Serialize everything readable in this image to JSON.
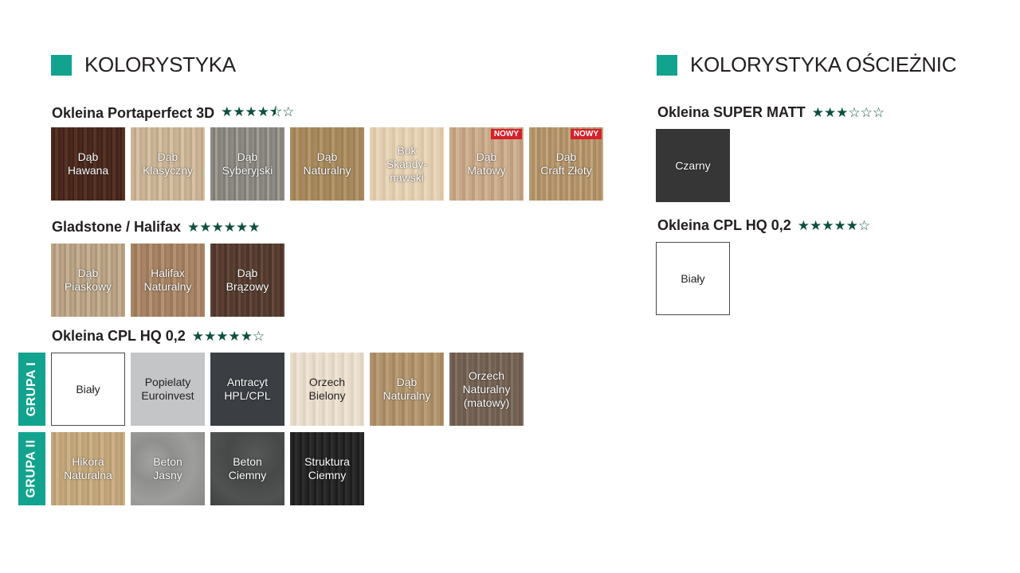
{
  "left": {
    "title": "KOLORYSTYKA",
    "groups": [
      {
        "name": "Okleina Portaperfect 3D",
        "stars": "★★★★⯪☆",
        "rating": 4.5,
        "swatches": [
          {
            "label": "Dąb\nHawana"
          },
          {
            "label": "Dąb\nKlasyczny"
          },
          {
            "label": "Dąb\nSyberyjski"
          },
          {
            "label": "Dąb\nNaturalny"
          },
          {
            "label": "Buk\nSkandy-\nnawski"
          },
          {
            "label": "Dąb\nMatowy",
            "badge": "NOWY"
          },
          {
            "label": "Dąb\nCraft Złoty",
            "badge": "NOWY"
          }
        ]
      },
      {
        "name": "Gladstone / Halifax",
        "stars": "★★★★★★",
        "rating": 6,
        "swatches": [
          {
            "label": "Dąb\nPiaskowy"
          },
          {
            "label": "Halifax\nNaturalny"
          },
          {
            "label": "Dąb\nBrązowy"
          }
        ]
      },
      {
        "name": "Okleina CPL HQ 0,2",
        "stars": "★★★★★☆",
        "rating": 5,
        "grupa1": {
          "label": "GRUPA I",
          "swatches": [
            {
              "label": "Biały"
            },
            {
              "label": "Popielaty\nEuroinvest"
            },
            {
              "label": "Antracyt\nHPL/CPL"
            },
            {
              "label": "Orzech\nBielony"
            },
            {
              "label": "Dąb\nNaturalny"
            },
            {
              "label": "Orzech\nNaturalny\n(matowy)"
            }
          ]
        },
        "grupa2": {
          "label": "GRUPA II",
          "swatches": [
            {
              "label": "Hikora\nNaturalna"
            },
            {
              "label": "Beton\nJasny"
            },
            {
              "label": "Beton\nCiemny"
            },
            {
              "label": "Struktura\nCiemny"
            }
          ]
        }
      }
    ]
  },
  "right": {
    "title": "KOLORYSTYKA OŚCIEŻNIC",
    "groups": [
      {
        "name": "Okleina SUPER MATT",
        "stars": "★★★☆☆☆",
        "rating": 3,
        "swatches": [
          {
            "label": "Czarny"
          }
        ]
      },
      {
        "name": "Okleina CPL HQ 0,2",
        "stars": "★★★★★☆",
        "rating": 5,
        "swatches": [
          {
            "label": "Biały"
          }
        ]
      }
    ]
  }
}
